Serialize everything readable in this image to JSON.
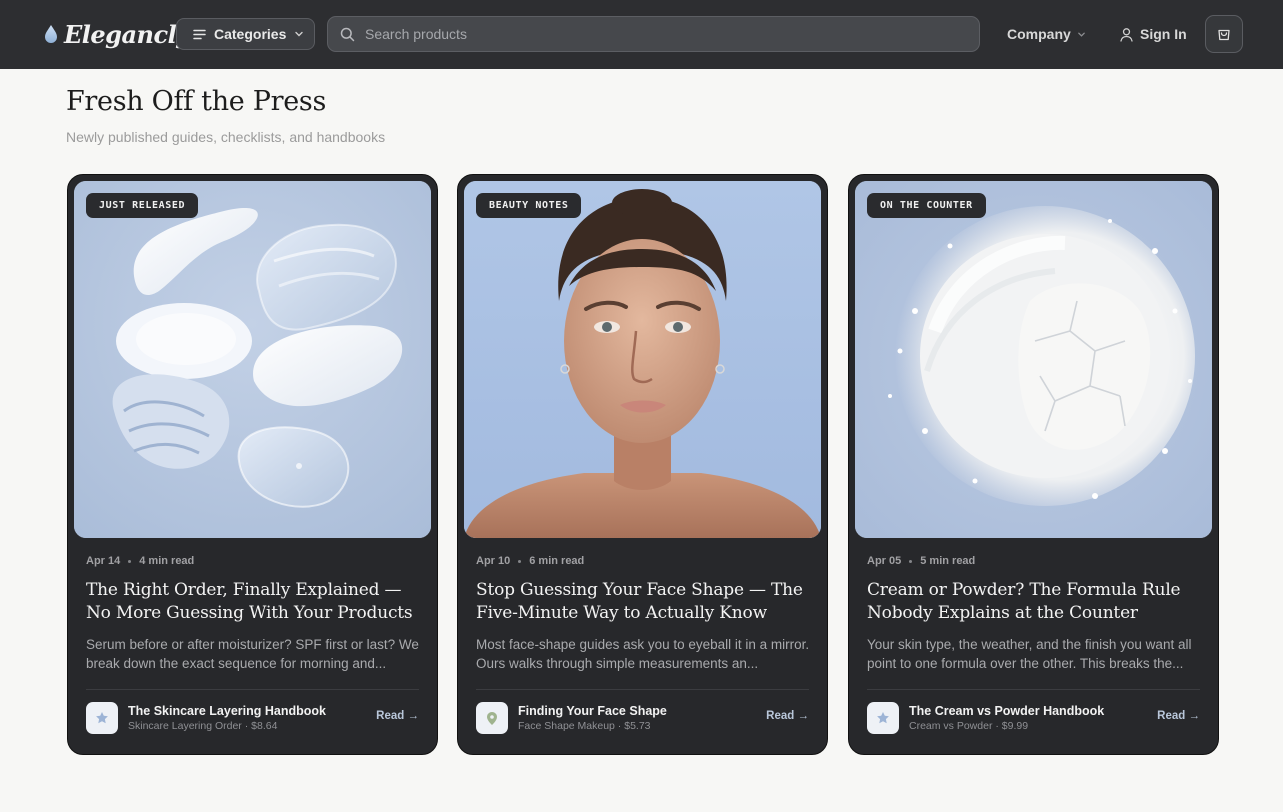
{
  "brand": {
    "name": "Elegancly"
  },
  "nav": {
    "categories_label": "Categories",
    "search_placeholder": "Search products",
    "company_label": "Company",
    "signin_label": "Sign In"
  },
  "section": {
    "title": "Fresh Off the Press",
    "subtitle": "Newly published guides, checklists, and handbooks"
  },
  "colors": {
    "header_bg": "#2d2e31",
    "card_bg": "#27282b",
    "accent_link": "#b9c7da",
    "image_bg": "#b8c7dd"
  },
  "cards": [
    {
      "badge": "JUST RELEASED",
      "image": "skincare-texture-swatches",
      "date": "Apr 14",
      "read_time": "4 min read",
      "title": "The Right Order, Finally Explained — No More Guessing With Your Products",
      "description": "Serum before or after moisturizer? SPF first or last? We break down the exact sequence for morning and...",
      "product_icon": "star-icon",
      "product_name": "The Skincare Layering Handbook",
      "product_sub": "Skincare Layering Order · $8.64",
      "cta": "Read →"
    },
    {
      "badge": "BEAUTY NOTES",
      "image": "woman-portrait",
      "date": "Apr 10",
      "read_time": "6 min read",
      "title": "Stop Guessing Your Face Shape — The Five-Minute Way to Actually Know",
      "description": "Most face-shape guides ask you to eyeball it in a mirror. Ours walks through simple measurements an...",
      "product_icon": "map-pin-icon",
      "product_name": "Finding Your Face Shape",
      "product_sub": "Face Shape Makeup · $5.73",
      "cta": "Read →"
    },
    {
      "badge": "ON THE COUNTER",
      "image": "crushed-powder",
      "date": "Apr 05",
      "read_time": "5 min read",
      "title": "Cream or Powder? The Formula Rule Nobody Explains at the Counter",
      "description": "Your skin type, the weather, and the finish you want all point to one formula over the other. This breaks the...",
      "product_icon": "star-icon",
      "product_name": "The Cream vs Powder Handbook",
      "product_sub": "Cream vs Powder · $9.99",
      "cta": "Read →"
    }
  ]
}
